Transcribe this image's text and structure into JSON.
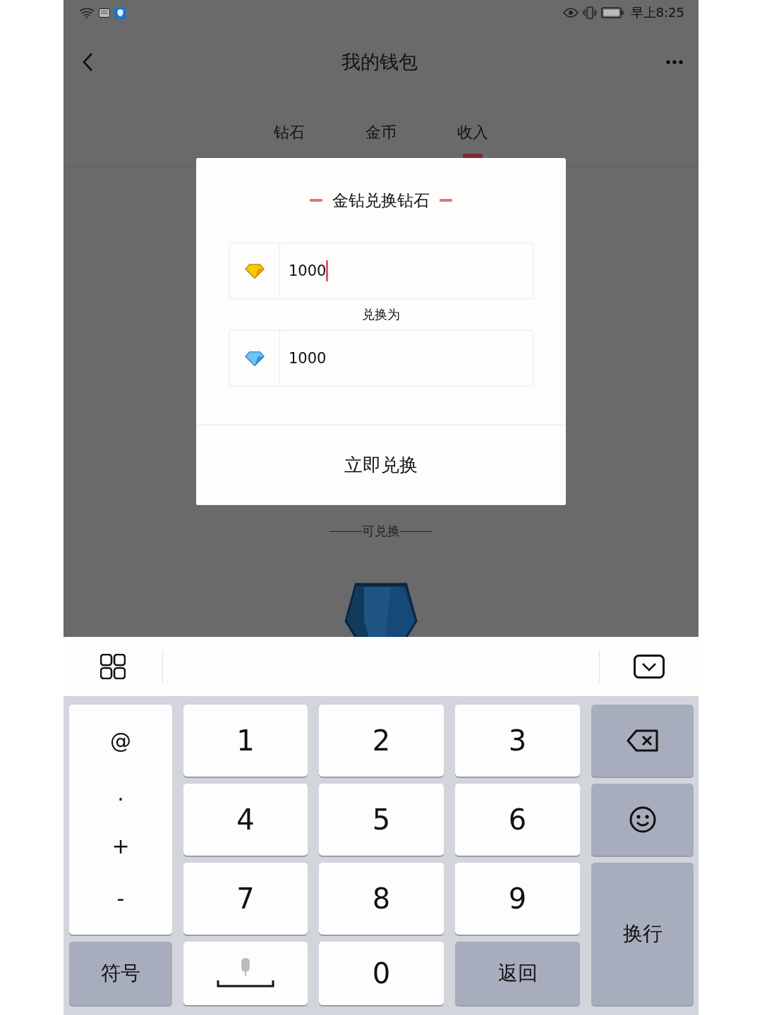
{
  "status_bar": {
    "time": "早上8:25"
  },
  "header": {
    "title": "我的钱包"
  },
  "tabs": [
    {
      "label": "钻石",
      "selected": false
    },
    {
      "label": "金币",
      "selected": false
    },
    {
      "label": "收入",
      "selected": true
    }
  ],
  "section_label": "可兑换",
  "dialog": {
    "title": "金钻兑换钻石",
    "fields": [
      {
        "kind": "gold",
        "value": "1000",
        "focused": true
      },
      {
        "kind": "blue",
        "value": "1000",
        "focused": false
      }
    ],
    "separator_label": "兑换为",
    "button": "立即兑换"
  },
  "keyboard": {
    "side_keys": [
      "@",
      ".",
      "+",
      "-"
    ],
    "keys": [
      {
        "kind": "light",
        "label": "1"
      },
      {
        "kind": "light",
        "label": "2"
      },
      {
        "kind": "light",
        "label": "3"
      },
      {
        "kind": "backspace"
      },
      {
        "kind": "light",
        "label": "4"
      },
      {
        "kind": "light",
        "label": "5"
      },
      {
        "kind": "light",
        "label": "6"
      },
      {
        "kind": "emoji"
      },
      {
        "kind": "light",
        "label": "7"
      },
      {
        "kind": "light",
        "label": "8"
      },
      {
        "kind": "light",
        "label": "9"
      },
      {
        "kind": "enter",
        "label": "换行"
      },
      {
        "kind": "gray",
        "label": "符号"
      },
      {
        "kind": "space"
      },
      {
        "kind": "light",
        "label": "0"
      },
      {
        "kind": "gray",
        "label": "返回"
      }
    ]
  }
}
